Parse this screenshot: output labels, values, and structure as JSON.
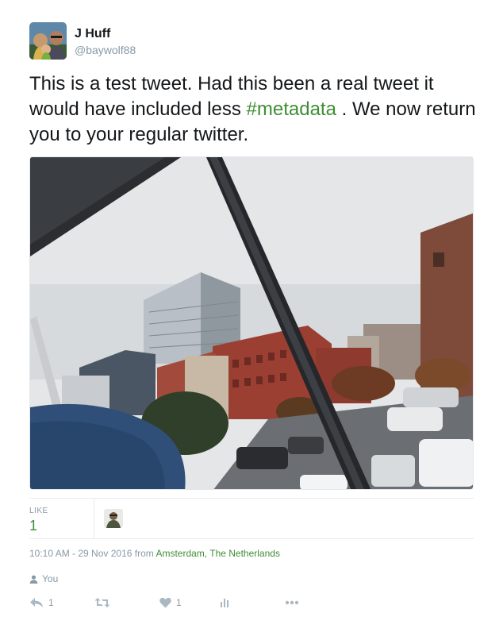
{
  "user": {
    "display_name": "J Huff",
    "handle": "@baywolf88"
  },
  "tweet": {
    "text_before": "This is a test tweet.  Had this been a real tweet it would have included less ",
    "hashtag": "#metadata",
    "text_after": " .  We now return you to your regular twitter."
  },
  "stats": {
    "likes_label": "LIKE",
    "likes_count": "1"
  },
  "meta": {
    "timestamp": "10:10 AM - 29 Nov 2016",
    "from_word": " from ",
    "location": "Amsterdam, The Netherlands"
  },
  "you": {
    "label": "You"
  },
  "actions": {
    "reply_count": "1",
    "like_count": "1"
  },
  "colors": {
    "accent": "#3f8d35",
    "muted": "#8899a6",
    "icon": "#aab8c2"
  }
}
